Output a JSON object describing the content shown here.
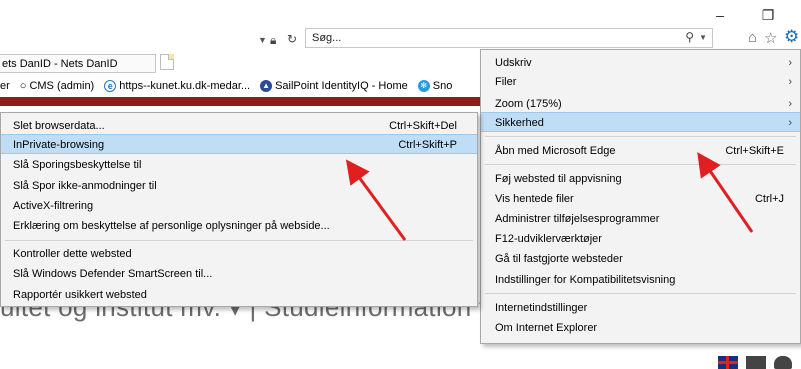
{
  "window": {
    "minimize_icon": "minimize-icon",
    "restore_icon": "restore-icon"
  },
  "addressbar": {
    "search_value": "Søg...",
    "icons": [
      "dropdown-icon",
      "lock-icon",
      "refresh-icon",
      "search-icon",
      "home-icon",
      "star-icon",
      "gear-icon"
    ]
  },
  "tabs": [
    {
      "label": "ets DanID - Nets DanID"
    }
  ],
  "favorites": [
    {
      "label": "er",
      "icon": ""
    },
    {
      "label": "CMS (admin)",
      "icon": "circle-icon"
    },
    {
      "label": "https--kunet.ku.dk-medar...",
      "icon": "ie-icon"
    },
    {
      "label": "SailPoint IdentityIQ - Home",
      "icon": "sailpoint-icon"
    },
    {
      "label": "Sno",
      "icon": "gear-blue-icon"
    }
  ],
  "background": {
    "nav_text": "ultet og institut mv. ▾  |  Studieinformation ▾  |"
  },
  "tools_menu": {
    "items": [
      {
        "label": "Udskriv",
        "submenu": true
      },
      {
        "label": "Filer",
        "submenu": true
      },
      {
        "label": "Zoom (175%)",
        "submenu": true
      },
      {
        "label": "Sikkerhed",
        "submenu": true,
        "highlighted": true
      },
      {
        "label": "Åbn med Microsoft Edge",
        "shortcut": "Ctrl+Skift+E"
      },
      {
        "label": "Føj websted til appvisning"
      },
      {
        "label": "Vis hentede filer",
        "shortcut": "Ctrl+J"
      },
      {
        "label": "Administrer tilføjelsesprogrammer"
      },
      {
        "label": "F12-udviklerværktøjer"
      },
      {
        "label": "Gå til fastgjorte websteder"
      },
      {
        "label": "Indstillinger for Kompatibilitetsvisning"
      },
      {
        "label": "Internetindstillinger"
      },
      {
        "label": "Om Internet Explorer"
      }
    ]
  },
  "security_menu": {
    "items": [
      {
        "label": "Slet browserdata...",
        "shortcut": "Ctrl+Skift+Del"
      },
      {
        "label": "InPrivate-browsing",
        "shortcut": "Ctrl+Skift+P",
        "highlighted": true
      },
      {
        "label": "Slå Sporingsbeskyttelse til"
      },
      {
        "label": "Slå Spor ikke-anmodninger til"
      },
      {
        "label": "ActiveX-filtrering"
      },
      {
        "label": "Erklæring om beskyttelse af personlige oplysninger på webside..."
      },
      {
        "label": "Kontroller dette websted"
      },
      {
        "label": "Slå Windows Defender SmartScreen til..."
      },
      {
        "label": "Rapportér usikkert websted"
      }
    ]
  },
  "colors": {
    "highlight": "#bfddf5",
    "annotation_arrow": "#e02020",
    "page_band": "#8c1d1d"
  }
}
